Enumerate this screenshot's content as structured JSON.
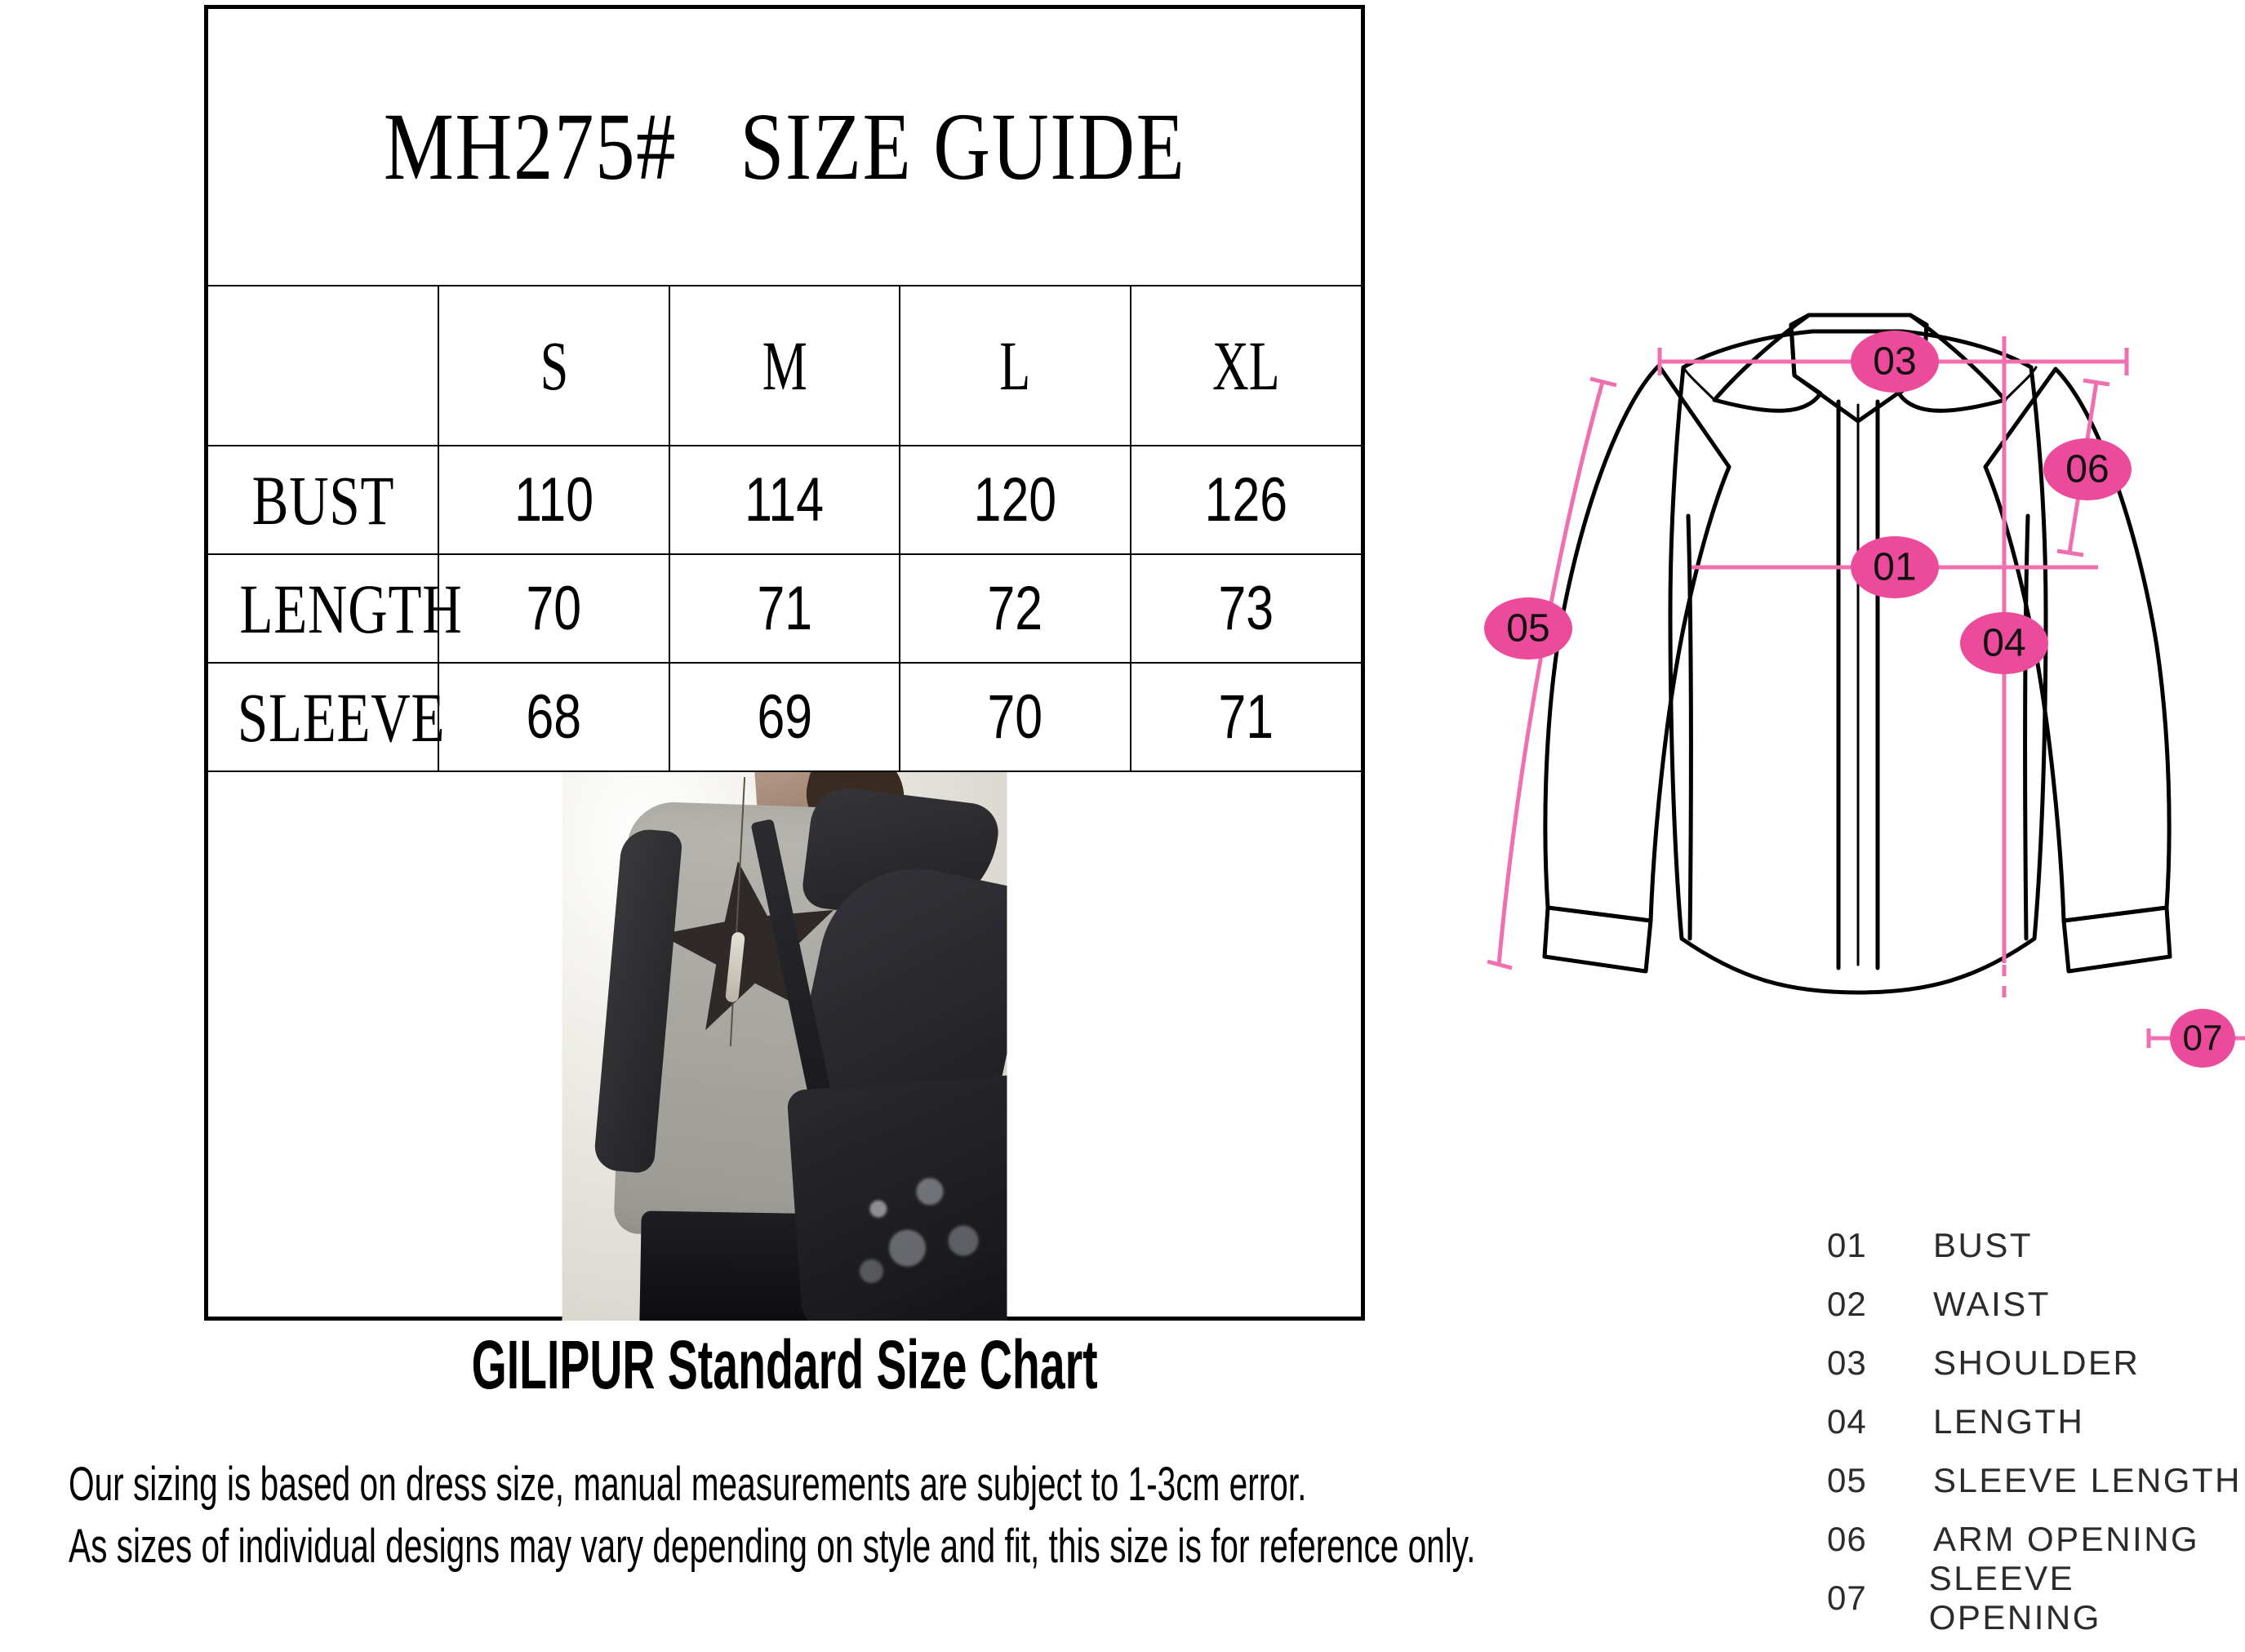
{
  "table": {
    "title": "MH275#   SIZE GUIDE",
    "size_headers": [
      "",
      "S",
      "M",
      "L",
      "XL"
    ],
    "rows": [
      {
        "label": "BUST",
        "values": [
          "110",
          "114",
          "120",
          "126"
        ]
      },
      {
        "label": "LENGTH",
        "values": [
          "70",
          "71",
          "72",
          "73"
        ]
      },
      {
        "label": "SLEEVE",
        "values": [
          "68",
          "69",
          "70",
          "71"
        ]
      }
    ],
    "photo_alt": "product-photo-grey-black-star-top"
  },
  "heading": "GILIPUR Standard Size Chart",
  "disclaimers": [
    "Our sizing is based on dress size, manual measurements are subject to 1-3cm error.",
    "As sizes of individual designs may vary depending on style and fit, this size is for reference only."
  ],
  "technical_drawing": {
    "markers": [
      {
        "id": "01",
        "name": "bust-marker"
      },
      {
        "id": "03",
        "name": "shoulder-marker"
      },
      {
        "id": "04",
        "name": "length-marker"
      },
      {
        "id": "05",
        "name": "sleeve-length-marker"
      },
      {
        "id": "06",
        "name": "arm-opening-marker"
      },
      {
        "id": "07",
        "name": "sleeve-opening-marker"
      }
    ]
  },
  "legend": {
    "items": [
      {
        "num": "01",
        "label": "BUST"
      },
      {
        "num": "02",
        "label": "WAIST"
      },
      {
        "num": "03",
        "label": "SHOULDER"
      },
      {
        "num": "04",
        "label": "LENGTH"
      },
      {
        "num": "05",
        "label": "SLEEVE LENGTH"
      },
      {
        "num": "06",
        "label": "ARM OPENING"
      },
      {
        "num": "07",
        "label": "SLEEVE OPENING"
      }
    ]
  },
  "colors": {
    "accent_pink": "#EC4B9B",
    "line_pink": "#F06FAE",
    "garment_outline": "#000000",
    "table_border": "#000000",
    "text": "#000000",
    "legend_text": "#2B2B2B"
  }
}
